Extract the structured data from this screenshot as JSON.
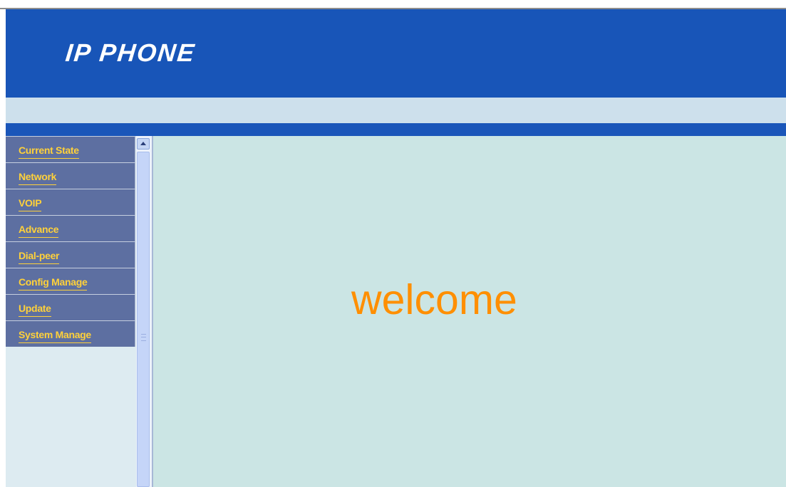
{
  "header": {
    "logo_text": "IP PHONE"
  },
  "sidebar": {
    "items": [
      {
        "label": "Current State"
      },
      {
        "label": "Network"
      },
      {
        "label": "VOIP"
      },
      {
        "label": "Advance"
      },
      {
        "label": "Dial-peer"
      },
      {
        "label": "Config Manage"
      },
      {
        "label": "Update"
      },
      {
        "label": "System Manage"
      }
    ]
  },
  "content": {
    "welcome_text": "welcome"
  },
  "colors": {
    "header_blue": "#1855b8",
    "nav_item_bg": "#5d6fa1",
    "nav_label": "#ffd13a",
    "content_bg": "#cbe5e4",
    "welcome_orange": "#ff8f00"
  },
  "icons": {
    "scroll_up": "chevron-up-icon"
  }
}
